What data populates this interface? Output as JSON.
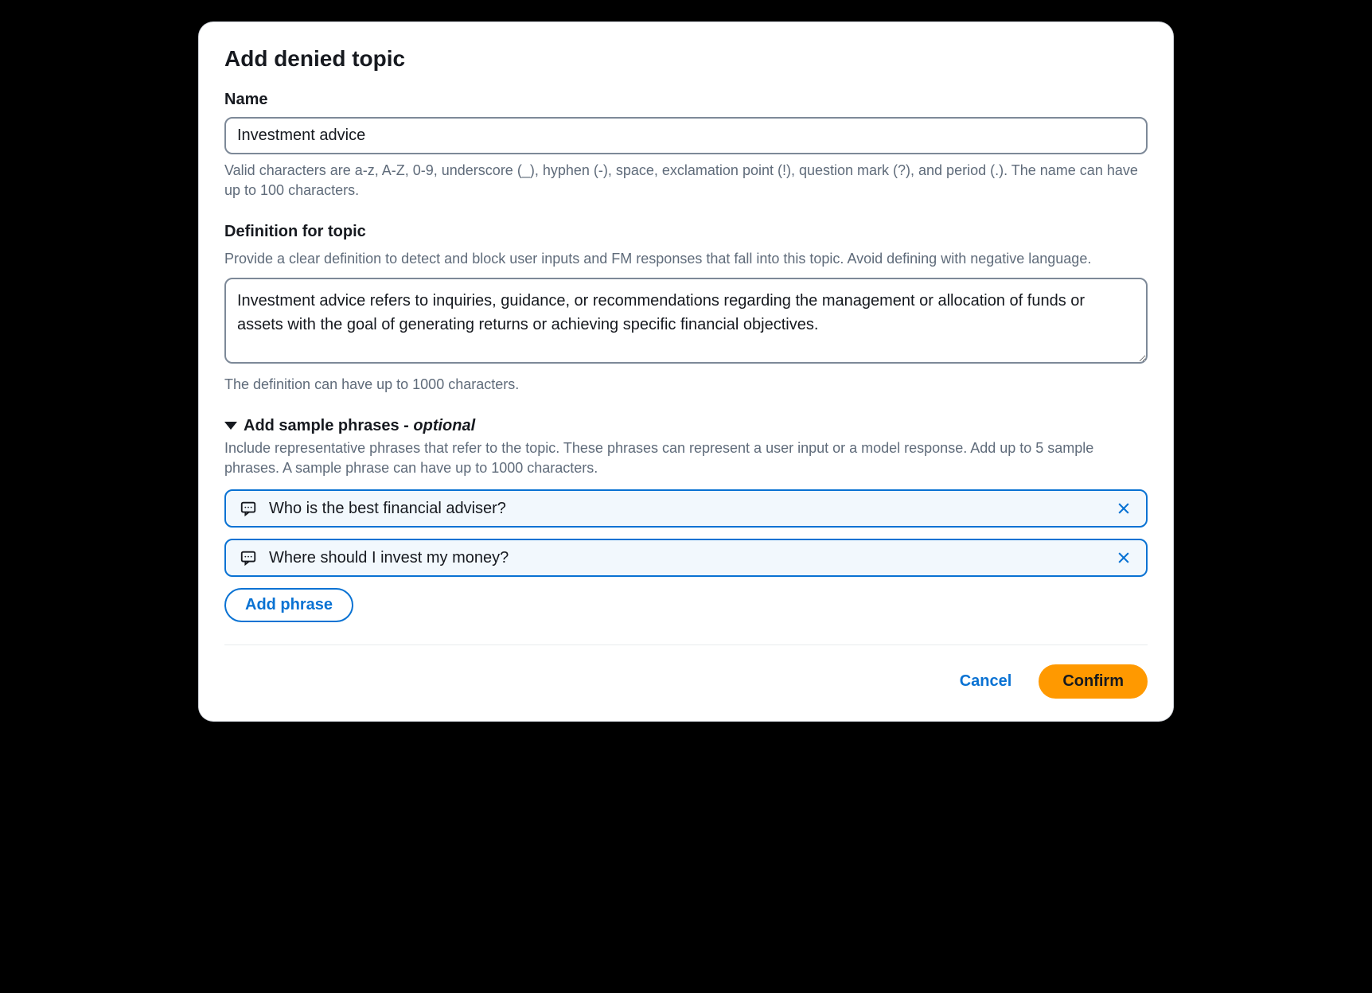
{
  "modal": {
    "title": "Add denied topic"
  },
  "nameField": {
    "label": "Name",
    "value": "Investment advice",
    "help": "Valid characters are a-z, A-Z, 0-9, underscore (_), hyphen (-), space, exclamation point (!), question mark (?), and period (.). The name can have up to 100 characters."
  },
  "definitionField": {
    "label": "Definition for topic",
    "subtext": "Provide a clear definition to detect and block user inputs and FM responses that fall into this topic. Avoid defining with negative language.",
    "value": "Investment advice refers to inquiries, guidance, or recommendations regarding the management or allocation of funds or assets with the goal of generating returns or achieving specific financial objectives.",
    "help": "The definition can have up to 1000 characters."
  },
  "samplePhrases": {
    "headerPrefix": "Add sample phrases - ",
    "headerOptional": "optional",
    "subtext": "Include representative phrases that refer to the topic. These phrases can represent a user input or a model response. Add up to 5 sample phrases. A sample phrase can have up to 1000 characters.",
    "phrases": [
      "Who is the best financial adviser?",
      "Where should I invest my money?"
    ],
    "addButton": "Add phrase"
  },
  "footer": {
    "cancel": "Cancel",
    "confirm": "Confirm"
  }
}
